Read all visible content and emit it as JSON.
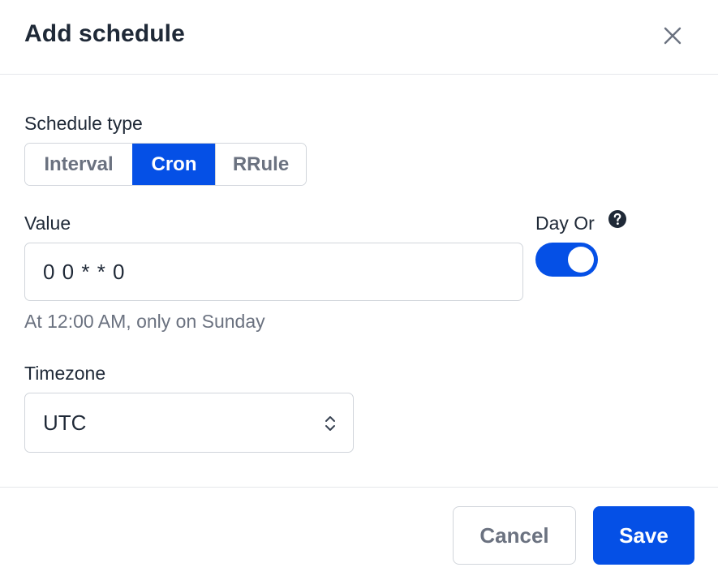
{
  "header": {
    "title": "Add schedule",
    "close_icon": "close-icon"
  },
  "schedule_type": {
    "label": "Schedule type",
    "options": [
      "Interval",
      "Cron",
      "RRule"
    ],
    "selected": "Cron"
  },
  "value": {
    "label": "Value",
    "input_value": "0 0 * * 0",
    "hint": "At 12:00 AM, only on Sunday"
  },
  "day_or": {
    "label": "Day Or",
    "help_icon": "question-circle-icon",
    "enabled": true
  },
  "timezone": {
    "label": "Timezone",
    "selected": "UTC",
    "chevron_icon": "chevron-up-down-icon"
  },
  "footer": {
    "cancel_label": "Cancel",
    "save_label": "Save"
  },
  "colors": {
    "accent": "#0550e6",
    "border": "#d1d5db",
    "muted_text": "#6b7280",
    "text": "#1f2937"
  }
}
